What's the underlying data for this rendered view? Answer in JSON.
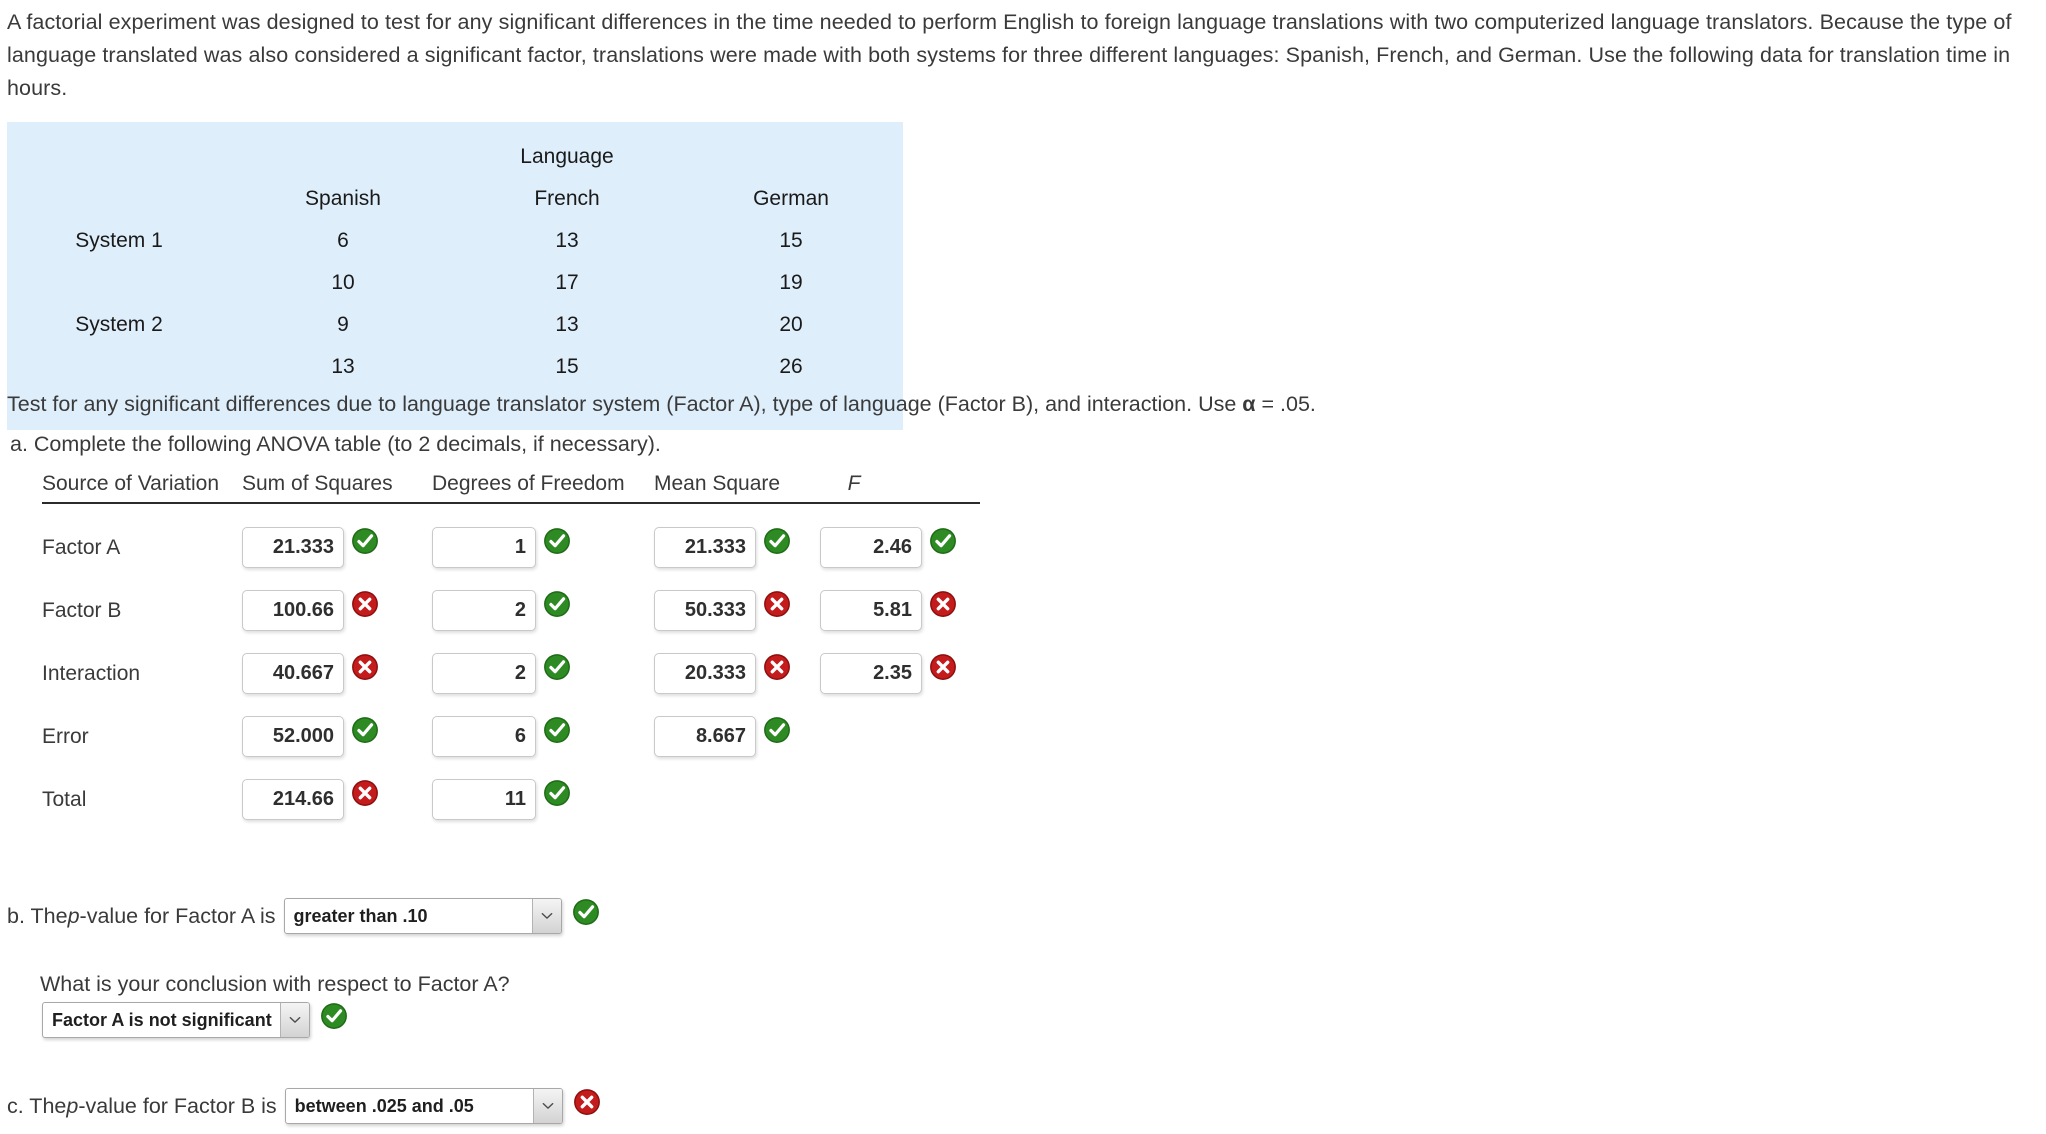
{
  "intro": {
    "paragraph": "A factorial experiment was designed to test for any significant differences in the time needed to perform English to foreign language translations with two computerized language translators. Because the type of language translated was also considered a significant factor, translations were made with both systems for three different languages: Spanish, French, and German. Use the following data for translation time in hours."
  },
  "data_table": {
    "group_header": "Language",
    "column_headers": [
      "Spanish",
      "French",
      "German"
    ],
    "row_labels": [
      "System 1",
      "",
      "System 2",
      ""
    ],
    "rows": [
      {
        "label": "System 1",
        "values": [
          "6",
          "13",
          "15"
        ]
      },
      {
        "label": "",
        "values": [
          "10",
          "17",
          "19"
        ]
      },
      {
        "label": "System 2",
        "values": [
          "9",
          "13",
          "20"
        ]
      },
      {
        "label": "",
        "values": [
          "13",
          "15",
          "26"
        ]
      }
    ],
    "colors": {
      "background": "#dfeefb",
      "label": "#56b4ee",
      "header": "#111111"
    }
  },
  "prompts": {
    "test_line_before_alpha": "Test for any significant differences due to language translator system (Factor A), type of language (Factor B), and interaction. Use ",
    "alpha_symbol": "α",
    "test_line_after_alpha": " = .05.",
    "part_a": "a. Complete the following ANOVA table (to 2 decimals, if necessary)."
  },
  "anova": {
    "headers": {
      "source": "Source of Variation",
      "ss": "Sum of Squares",
      "df": "Degrees of Freedom",
      "ms": "Mean Square",
      "f": "F"
    },
    "rows": [
      {
        "label": "Factor A",
        "ss": {
          "value": "21.333",
          "status": "correct"
        },
        "df": {
          "value": "1",
          "status": "correct"
        },
        "ms": {
          "value": "21.333",
          "status": "correct"
        },
        "f": {
          "value": "2.46",
          "status": "correct"
        }
      },
      {
        "label": "Factor B",
        "ss": {
          "value": "100.66",
          "status": "incorrect"
        },
        "df": {
          "value": "2",
          "status": "correct"
        },
        "ms": {
          "value": "50.333",
          "status": "incorrect"
        },
        "f": {
          "value": "5.81",
          "status": "incorrect"
        }
      },
      {
        "label": "Interaction",
        "ss": {
          "value": "40.667",
          "status": "incorrect"
        },
        "df": {
          "value": "2",
          "status": "correct"
        },
        "ms": {
          "value": "20.333",
          "status": "incorrect"
        },
        "f": {
          "value": "2.35",
          "status": "incorrect"
        }
      },
      {
        "label": "Error",
        "ss": {
          "value": "52.000",
          "status": "correct"
        },
        "df": {
          "value": "6",
          "status": "correct"
        },
        "ms": {
          "value": "8.667",
          "status": "correct"
        },
        "f": {
          "value": "",
          "status": "none"
        }
      },
      {
        "label": "Total",
        "ss": {
          "value": "214.66",
          "status": "incorrect"
        },
        "df": {
          "value": "11",
          "status": "correct"
        },
        "ms": {
          "value": "",
          "status": "none"
        },
        "f": {
          "value": "",
          "status": "none"
        }
      }
    ]
  },
  "part_b": {
    "text_before": "b. The ",
    "italic_p": "p",
    "text_after": "-value for Factor A is",
    "select_value": "greater than .10",
    "status": "correct",
    "sub_question": "What is your conclusion with respect to Factor A?",
    "sub_select_value": "Factor A is not significant",
    "sub_status": "correct"
  },
  "part_c": {
    "text_before": "c. The ",
    "italic_p": "p",
    "text_after": "-value for Factor B is",
    "select_value": "between .025 and .05",
    "status": "incorrect"
  },
  "icons": {
    "correct": "green-check-circle-icon",
    "incorrect": "red-x-circle-icon",
    "dropdown": "chevron-down-icon"
  },
  "colors": {
    "correct_green": "#2e8b23",
    "incorrect_red": "#c41c1c",
    "accent_blue": "#56b4ee",
    "table_bg": "#dfeefb"
  }
}
